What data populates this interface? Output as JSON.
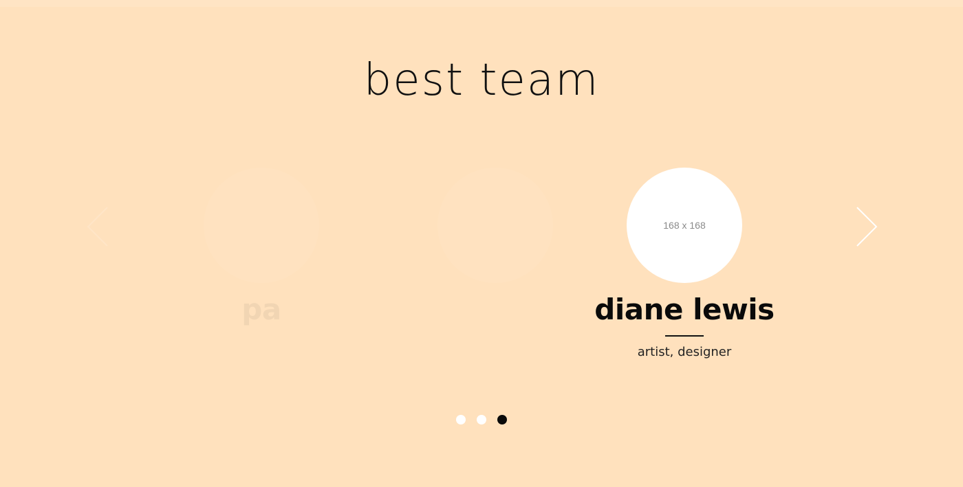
{
  "section": {
    "title": "best team"
  },
  "carousel": {
    "members": [
      {
        "name": "pa",
        "role": "",
        "avatar_text": ""
      },
      {
        "name": "",
        "role": "",
        "avatar_text": ""
      },
      {
        "name": "diane lewis",
        "role": "artist, designer",
        "avatar_text": "168 x 168"
      }
    ],
    "prev_icon": "chevron-left-icon",
    "next_icon": "chevron-right-icon",
    "dots": [
      {
        "label": "",
        "active": false
      },
      {
        "label": "",
        "active": false
      },
      {
        "label": "",
        "active": true
      }
    ]
  },
  "colors": {
    "background": "#ffe1bd",
    "accent": "#0a0a0a",
    "avatar": "#ffffff"
  }
}
